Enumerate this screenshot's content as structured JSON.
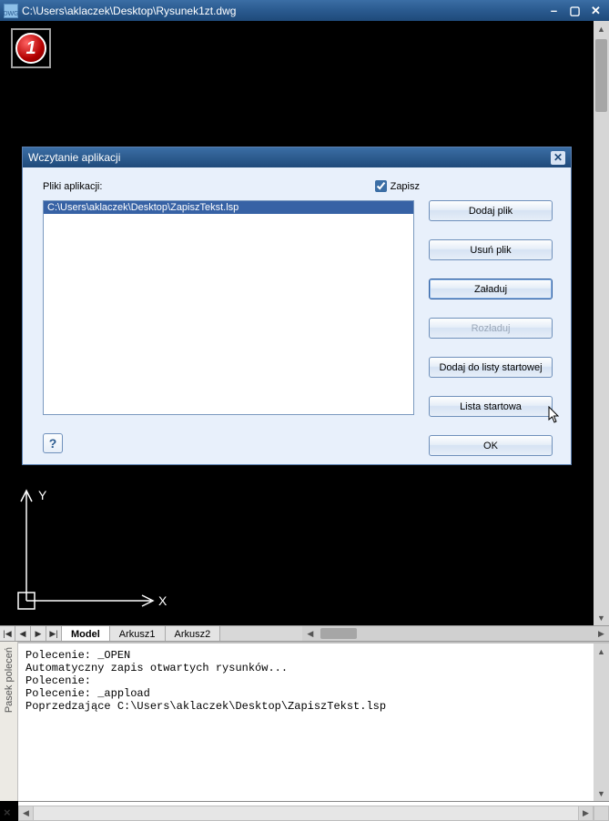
{
  "main_window": {
    "title": "C:\\Users\\aklaczek\\Desktop\\Rysunek1zt.dwg",
    "app_icon_text": "DWG"
  },
  "marker": {
    "number": "1"
  },
  "dialog": {
    "title": "Wczytanie aplikacji",
    "files_label": "Pliki aplikacji:",
    "save_checkbox_label": "Zapisz",
    "save_checked": true,
    "list_items": [
      "C:\\Users\\aklaczek\\Desktop\\ZapiszTekst.lsp"
    ],
    "buttons": {
      "add_file": "Dodaj plik",
      "remove_file": "Usuń plik",
      "load": "Załaduj",
      "unload": "Rozładuj",
      "add_to_startup": "Dodaj do listy startowej",
      "startup_list": "Lista startowa",
      "ok": "OK"
    },
    "help": "?"
  },
  "ucs": {
    "x": "X",
    "y": "Y"
  },
  "tabs": {
    "nav": {
      "first": "|◀",
      "prev": "◀",
      "next": "▶",
      "last": "▶|"
    },
    "items": [
      {
        "label": "Model",
        "active": true
      },
      {
        "label": "Arkusz1",
        "active": false
      },
      {
        "label": "Arkusz2",
        "active": false
      }
    ]
  },
  "command_panel": {
    "sidebar_label": "Pasek poleceń",
    "lines": [
      "Polecenie: _OPEN",
      "Automatyczny zapis otwartych rysunków...",
      "Polecenie:",
      "Polecenie: _appload",
      "Poprzedzające C:\\Users\\aklaczek\\Desktop\\ZapiszTekst.lsp"
    ],
    "close_label": "×"
  }
}
